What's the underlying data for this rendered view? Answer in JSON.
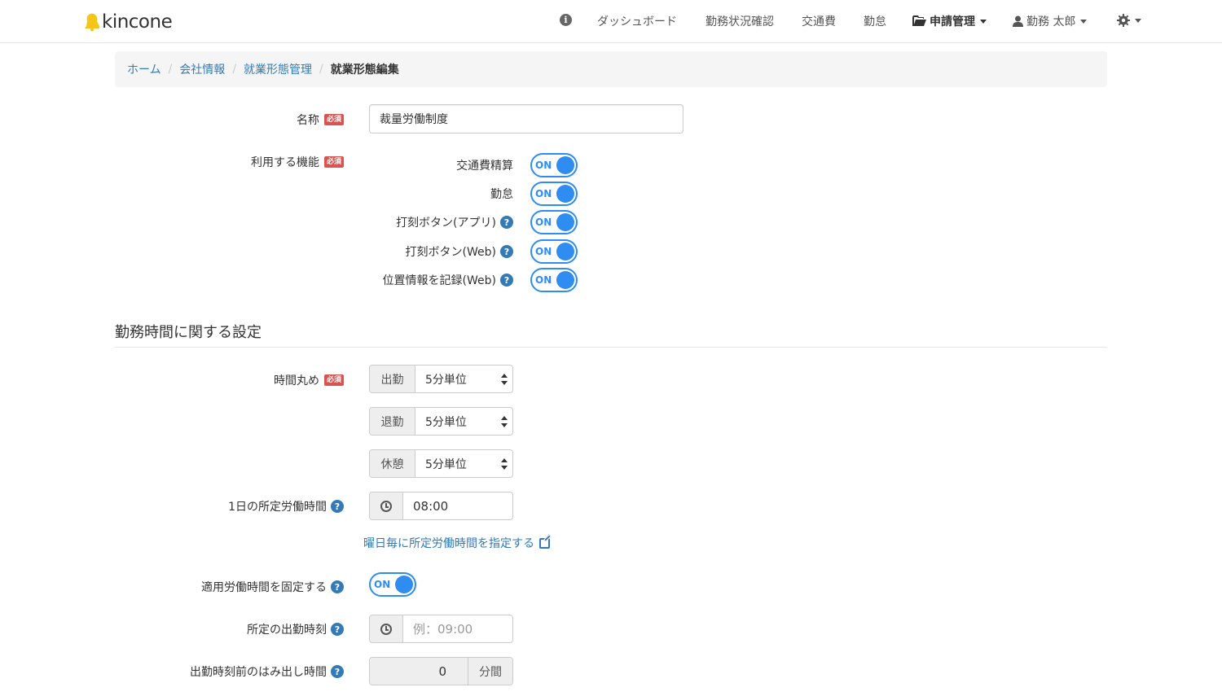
{
  "brand": {
    "name": "kincone"
  },
  "nav": {
    "items": [
      "ダッシュボード",
      "勤務状況確認",
      "交通費",
      "勤怠"
    ],
    "apply_menu": "申請管理",
    "user_menu": "勤務 太郎"
  },
  "breadcrumb": {
    "items": [
      "ホーム",
      "会社情報",
      "就業形態管理"
    ],
    "active": "就業形態編集"
  },
  "required_badge": "必須",
  "form": {
    "name_label": "名称",
    "name_value": "裁量労働制度",
    "features_label": "利用する機能",
    "features": [
      {
        "label": "交通費精算",
        "value": "ON",
        "help": false
      },
      {
        "label": "勤怠",
        "value": "ON",
        "help": false
      },
      {
        "label": "打刻ボタン(アプリ)",
        "value": "ON",
        "help": true
      },
      {
        "label": "打刻ボタン(Web)",
        "value": "ON",
        "help": true
      },
      {
        "label": "位置情報を記録(Web)",
        "value": "ON",
        "help": true
      }
    ]
  },
  "work_time_section": {
    "title": "勤務時間に関する設定",
    "rounding_label": "時間丸め",
    "rounding": [
      {
        "addon": "出勤",
        "value": "5分単位"
      },
      {
        "addon": "退勤",
        "value": "5分単位"
      },
      {
        "addon": "休憩",
        "value": "5分単位"
      }
    ],
    "daily_hours_label": "1日の所定労働時間",
    "daily_hours_value": "08:00",
    "weekday_link": "曜日毎に所定労働時間を指定する",
    "fixed_label": "適用労働時間を固定する",
    "fixed_value": "ON",
    "start_time_label": "所定の出勤時刻",
    "start_time_placeholder": "例：09:00",
    "overflow_label": "出勤時刻前のはみ出し時間",
    "overflow_value": "0",
    "overflow_unit": "分間"
  },
  "colors": {
    "toggle": "#2f8cf0",
    "link": "#337ab7",
    "required": "#d9534f",
    "logo": "#f5c518"
  }
}
